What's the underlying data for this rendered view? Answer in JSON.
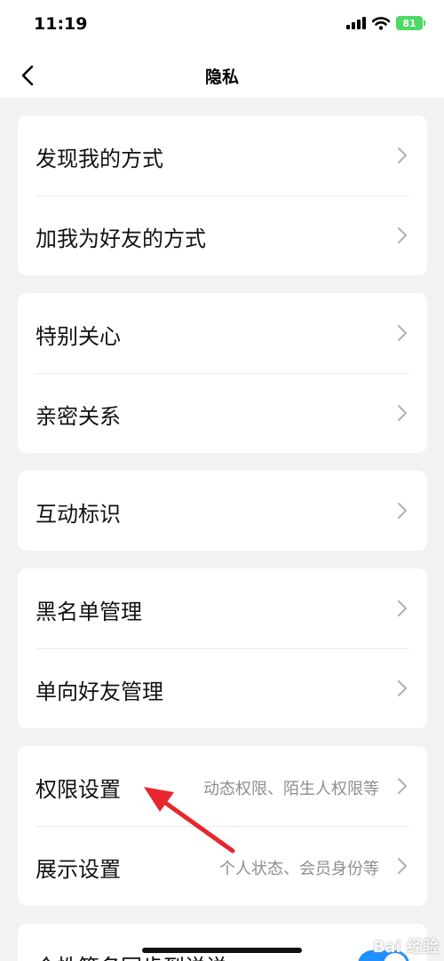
{
  "status_bar": {
    "time": "11:19",
    "battery": "81",
    "icons": [
      "signal-icon",
      "wifi-icon",
      "battery-icon"
    ]
  },
  "nav": {
    "title": "隐私",
    "back_icon": "chevron-left-icon"
  },
  "groups": [
    {
      "items": [
        {
          "label": "发现我的方式"
        },
        {
          "label": "加我为好友的方式"
        }
      ]
    },
    {
      "items": [
        {
          "label": "特别关心"
        },
        {
          "label": "亲密关系"
        }
      ]
    },
    {
      "items": [
        {
          "label": "互动标识"
        }
      ]
    },
    {
      "items": [
        {
          "label": "黑名单管理"
        },
        {
          "label": "单向好友管理"
        }
      ]
    },
    {
      "items": [
        {
          "label": "权限设置",
          "detail": "动态权限、陌生人权限等"
        },
        {
          "label": "展示设置",
          "detail": "个人状态、会员身份等"
        }
      ]
    },
    {
      "items": [
        {
          "label": "个性签名同步到说说",
          "toggle": true
        }
      ]
    }
  ],
  "colors": {
    "accent": "#1e90ff",
    "annotation_arrow": "#e8262d",
    "battery": "#4cd964",
    "background": "#f2f2f4"
  },
  "watermark": "Bai 经验"
}
